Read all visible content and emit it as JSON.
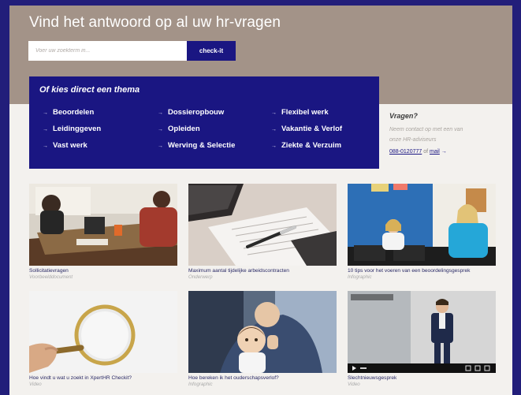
{
  "hero": {
    "title": "Vind het antwoord op al uw hr-vragen",
    "search_placeholder": "Voer uw zoekterm in...",
    "search_button": "check-it"
  },
  "themes": {
    "title": "Of kies direct een thema",
    "items": [
      {
        "label": "Beoordelen"
      },
      {
        "label": "Leidinggeven"
      },
      {
        "label": "Vast werk"
      },
      {
        "label": "Dossieropbouw"
      },
      {
        "label": "Opleiden"
      },
      {
        "label": "Werving & Selectie"
      },
      {
        "label": "Flexibel werk"
      },
      {
        "label": "Vakantie & Verlof"
      },
      {
        "label": "Ziekte & Verzuim"
      }
    ]
  },
  "contact": {
    "title": "Vragen?",
    "text_line1": "Neem contact op met een van",
    "text_line2": "onze HR-adviseurs",
    "phone": "088-0120777",
    "or": "of",
    "mail": "mail",
    "arrow": "→"
  },
  "cards": [
    {
      "title": "Sollicitatievragen",
      "type": "Voorbeelddocument"
    },
    {
      "title": "Maximum aantal tijdelijke arbeidscontracten",
      "type": "Onderwerp"
    },
    {
      "title": "10 tips voor het voeren van een beoordelingsgesprek",
      "type": "Infographic"
    },
    {
      "title": "Hoe vindt u wat u zoekt in XpertHR Checkit?",
      "type": "Video"
    },
    {
      "title": "Hoe bereken ik het ouderschapsverlof?",
      "type": "Infographic"
    },
    {
      "title": "Slechtnieuwsgesprek",
      "type": "Video"
    }
  ],
  "colors": {
    "frame": "#221e7a",
    "hero": "#a39388",
    "brand": "#1a1682",
    "page": "#f3f1ee"
  },
  "icons": {
    "link_arrow": "→"
  }
}
